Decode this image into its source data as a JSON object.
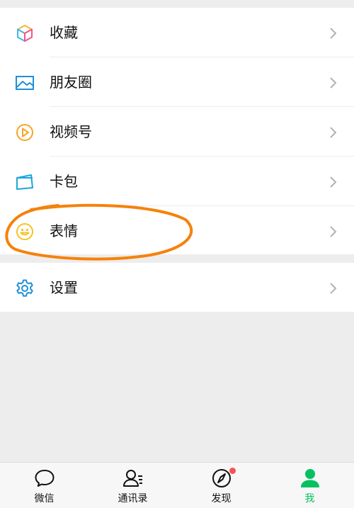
{
  "menu": {
    "items": [
      {
        "label": "收藏",
        "icon": "favorites-cube-icon"
      },
      {
        "label": "朋友圈",
        "icon": "moments-picture-icon"
      },
      {
        "label": "视频号",
        "icon": "channels-play-icon"
      },
      {
        "label": "卡包",
        "icon": "card-wallet-icon"
      },
      {
        "label": "表情",
        "icon": "sticker-smiley-icon"
      }
    ],
    "settings": {
      "label": "设置",
      "icon": "gear-icon"
    }
  },
  "annotation": {
    "color": "#f5820b",
    "description": "hand-drawn orange ellipse around 表情"
  },
  "tabbar": {
    "tabs": [
      {
        "label": "微信",
        "icon": "chat-bubble-icon"
      },
      {
        "label": "通讯录",
        "icon": "contacts-icon"
      },
      {
        "label": "发现",
        "icon": "compass-icon",
        "badge": "red-dot"
      },
      {
        "label": "我",
        "icon": "profile-person-icon",
        "active": true
      }
    ]
  },
  "colors": {
    "accent": "#07c160",
    "badge": "#fa5151",
    "background": "#ededed"
  }
}
